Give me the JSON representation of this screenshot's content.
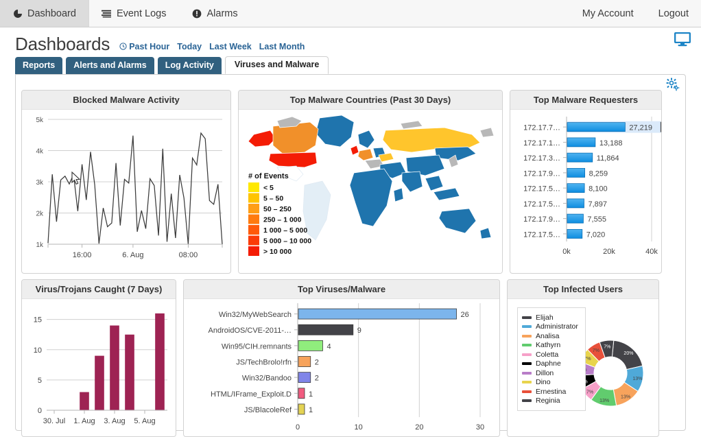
{
  "topnav": {
    "items": [
      {
        "label": "Dashboard",
        "icon": "pie-chart-icon",
        "active": true
      },
      {
        "label": "Event Logs",
        "icon": "list-icon",
        "active": false
      },
      {
        "label": "Alarms",
        "icon": "alert-circle-icon",
        "active": false
      }
    ],
    "account_label": "My Account",
    "logout_label": "Logout"
  },
  "page": {
    "title": "Dashboards",
    "time_links": [
      "Past Hour",
      "Today",
      "Last Week",
      "Last Month"
    ],
    "monitor_icon": "monitor-icon",
    "gear_icon": "gear-icon"
  },
  "tabs": [
    {
      "label": "Reports",
      "active": false
    },
    {
      "label": "Alerts and Alarms",
      "active": false
    },
    {
      "label": "Log Activity",
      "active": false
    },
    {
      "label": "Viruses and Malware",
      "active": true
    }
  ],
  "chart_data": [
    {
      "id": "blocked-malware-activity",
      "type": "line",
      "title": "Blocked Malware Activity",
      "xlabel": "",
      "ylabel": "",
      "ylim": [
        1000,
        5000
      ],
      "ytick_labels": [
        "1k",
        "2k",
        "3k",
        "4k",
        "5k"
      ],
      "ytick_values": [
        1000,
        2000,
        3000,
        4000,
        5000
      ],
      "xtick_labels": [
        "16:00",
        "6. Aug",
        "08:00"
      ],
      "grid": true,
      "line_color": "#3b3b3b",
      "values": [
        1030,
        3240,
        1720,
        3060,
        3180,
        2930,
        3240,
        2060,
        3560,
        2420,
        3960,
        2900,
        1020,
        2160,
        1560,
        1680,
        3600,
        1600,
        3080,
        2960,
        4480,
        1400,
        2080,
        1500,
        3100,
        2880,
        1280,
        4060,
        1080,
        2620,
        1200,
        3220,
        2480,
        1000,
        3760,
        3540,
        4560,
        4380,
        2400,
        2280,
        2920,
        1000
      ]
    },
    {
      "id": "top-malware-countries",
      "type": "map",
      "title": "Top Malware Countries (Past 30 Days)",
      "legend_title": "# of Events",
      "legend_entries": [
        {
          "label": "< 5",
          "color": "#ffe800"
        },
        {
          "label": "5 – 50",
          "color": "#ffc400"
        },
        {
          "label": "50 – 250",
          "color": "#ff9e16"
        },
        {
          "label": "250 – 1 000",
          "color": "#ff7b0f"
        },
        {
          "label": "1 000 – 5 000",
          "color": "#ff5a0a"
        },
        {
          "label": "5 000 – 10 000",
          "color": "#fb3b08"
        },
        {
          "label": "> 10 000",
          "color": "#f41c05"
        }
      ],
      "region_colors": {
        "no_data": "#b8b8b8",
        "low": "#1f74ad",
        "mid": "#ffc52c",
        "high_orange": "#f1902a",
        "highest": "#f41c05"
      }
    },
    {
      "id": "top-malware-requesters",
      "type": "bar",
      "orientation": "horizontal",
      "title": "Top Malware Requesters",
      "xlabel": "",
      "xtick_labels": [
        "0k",
        "20k",
        "40k"
      ],
      "xlim": [
        0,
        40000
      ],
      "bar_color": "#1e9ae8",
      "categories": [
        "172.17.7…",
        "172.17.1…",
        "172.17.3…",
        "172.17.9…",
        "172.17.5…",
        "172.17.5…",
        "172.17.9…",
        "172.17.5…"
      ],
      "values": [
        27219,
        13188,
        11864,
        8259,
        8100,
        7897,
        7555,
        7020
      ],
      "value_labels": [
        "27,219",
        "13,188",
        "11,864",
        "8,259",
        "8,100",
        "7,897",
        "7,555",
        "7,020"
      ],
      "selected_index": 0
    },
    {
      "id": "virus-trojans-caught",
      "type": "bar",
      "orientation": "vertical",
      "title": "Virus/Trojans Caught (7 Days)",
      "ylim": [
        0,
        17
      ],
      "ytick_labels": [
        "0",
        "5",
        "10",
        "15"
      ],
      "ytick_values": [
        0,
        5,
        10,
        15
      ],
      "xtick_labels": [
        "30. Jul",
        "1. Aug",
        "3. Aug",
        "5. Aug"
      ],
      "bar_color": "#9e2353",
      "categories": [
        "30. Jul",
        "31. Jul",
        "1. Aug",
        "2. Aug",
        "3. Aug",
        "4. Aug",
        "5. Aug",
        "6. Aug"
      ],
      "values": [
        0,
        0,
        3,
        9,
        14,
        12.5,
        0,
        16
      ]
    },
    {
      "id": "top-viruses-malware",
      "type": "bar",
      "orientation": "horizontal",
      "title": "Top Viruses/Malware",
      "xlim": [
        0,
        30
      ],
      "xtick_labels": [
        "0",
        "10",
        "20",
        "30"
      ],
      "xtick_values": [
        0,
        10,
        20,
        30
      ],
      "categories": [
        "Win32/MyWebSearch",
        "AndroidOS/CVE-2011-…",
        "Win95/CIH.remnants",
        "JS/TechBrolo!rfn",
        "Win32/Bandoo",
        "HTML/IFrame_Exploit.D",
        "JS/BlacoleRef"
      ],
      "values": [
        26,
        9,
        4,
        2,
        2,
        1,
        1
      ],
      "colors": [
        "#7cb5ec",
        "#434348",
        "#90ed7d",
        "#f7a35c",
        "#8085e9",
        "#f15c80",
        "#e4d354"
      ]
    },
    {
      "id": "top-infected-users",
      "type": "pie",
      "title": "Top Infected Users",
      "labels": [
        "Elijah",
        "Administrator",
        "Analisa",
        "Kathyrn",
        "Coletta",
        "Daphne",
        "Dillon",
        "Dino",
        "Ernestina",
        "Reginia"
      ],
      "values": [
        20,
        13,
        13,
        13,
        7,
        7,
        7,
        7,
        7,
        7
      ],
      "value_labels": [
        "20%",
        "13%",
        "13%",
        "13%",
        "7%",
        "7%",
        "7%",
        "7%",
        "7%",
        "7%"
      ],
      "colors": [
        "#434348",
        "#4fa9d8",
        "#f7a35c",
        "#61cc6e",
        "#f6a0c8",
        "#000000",
        "#b87dc8",
        "#e8d44d",
        "#e8503a",
        "#434348"
      ],
      "legend_position": "left",
      "donut": true
    }
  ]
}
